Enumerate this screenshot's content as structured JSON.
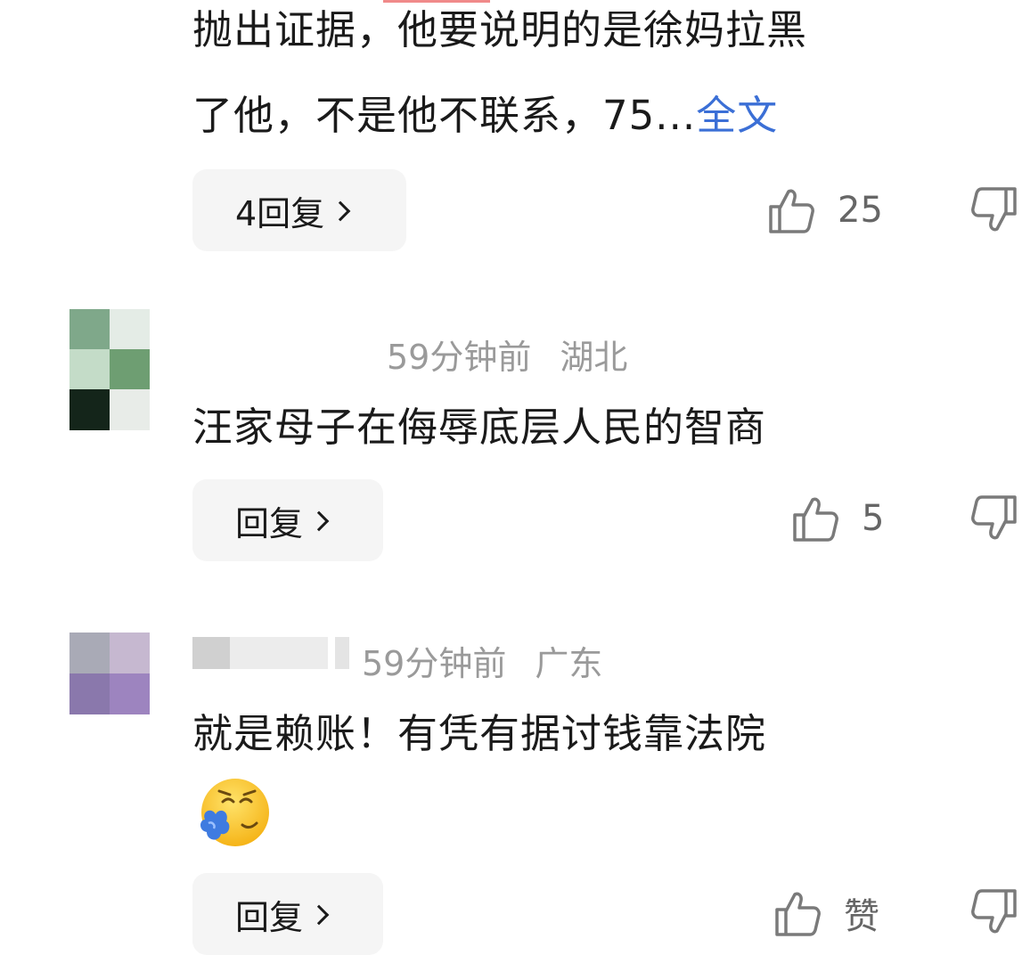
{
  "comments": [
    {
      "text_line1": "抛出证据，他要说明的是徐妈拉黑",
      "text_line2": "了他，不是他不联系，75...",
      "full_text_link": "全文",
      "reply_button": "4回复",
      "like_count": "25"
    },
    {
      "time": "59分钟前",
      "location": "湖北",
      "text": "汪家母子在侮辱底层人民的智商",
      "reply_button": "回复",
      "like_count": "5"
    },
    {
      "time": "59分钟前",
      "location": "广东",
      "text": "就是赖账！有凭有据讨钱靠法院",
      "emoji": "sneezing-sick-emoji",
      "reply_button": "回复",
      "like_label": "赞"
    }
  ],
  "icons": {
    "like": "thumbs-up-icon",
    "dislike": "thumbs-down-icon",
    "reply_arrow": "chevron-right-icon"
  },
  "colors": {
    "link": "#3b6fd6",
    "text": "#1a1a1a",
    "meta": "#9a9a9a",
    "reply_bg": "#f5f5f5"
  }
}
